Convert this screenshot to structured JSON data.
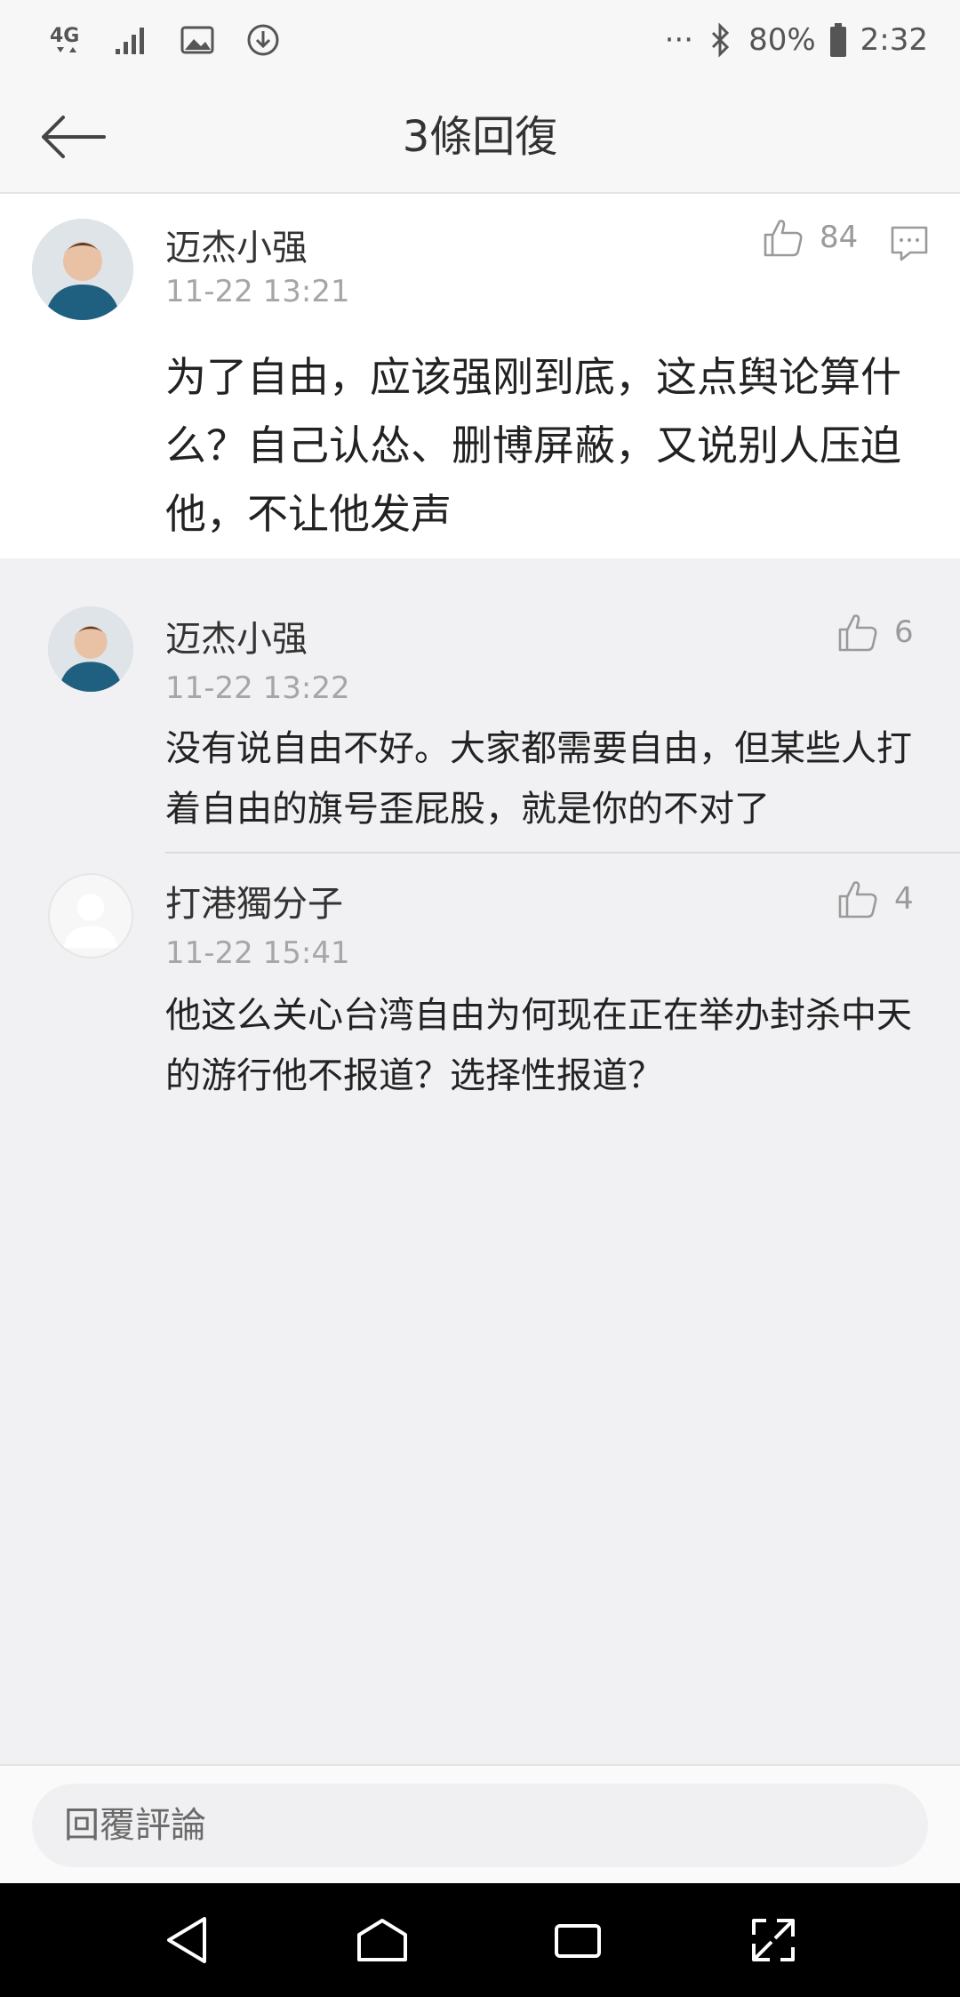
{
  "status_bar": {
    "network": "4G",
    "more": "···",
    "battery": "80%",
    "time": "2:32"
  },
  "header": {
    "title": "3條回復"
  },
  "main_comment": {
    "username": "迈杰小强",
    "time": "11-22 13:21",
    "likes": "84",
    "content": "为了自由，应该强刚到底，这点舆论算什么？自己认怂、删博屏蔽，又说别人压迫他，不让他发声"
  },
  "replies": [
    {
      "username": "迈杰小强",
      "time": "11-22 13:22",
      "likes": "6",
      "content": "没有说自由不好。大家都需要自由，但某些人打着自由的旗号歪屁股，就是你的不对了"
    },
    {
      "username": "打港獨分子",
      "time": "11-22 15:41",
      "likes": "4",
      "content": "他这么关心台湾自由为何现在正在举办封杀中天的游行他不报道？选择性报道？"
    }
  ],
  "reply_box": {
    "placeholder": "回覆評論"
  },
  "icons": {
    "back": "arrow-left-icon",
    "like": "thumbs-up-icon",
    "reply": "comment-bubble-icon",
    "nav": [
      "back-triangle-icon",
      "home-icon",
      "recents-icon",
      "expand-icon"
    ]
  },
  "colors": {
    "background": "#f1f1f3",
    "card": "#ffffff",
    "text": "#222222",
    "muted": "#a6a6a6"
  }
}
